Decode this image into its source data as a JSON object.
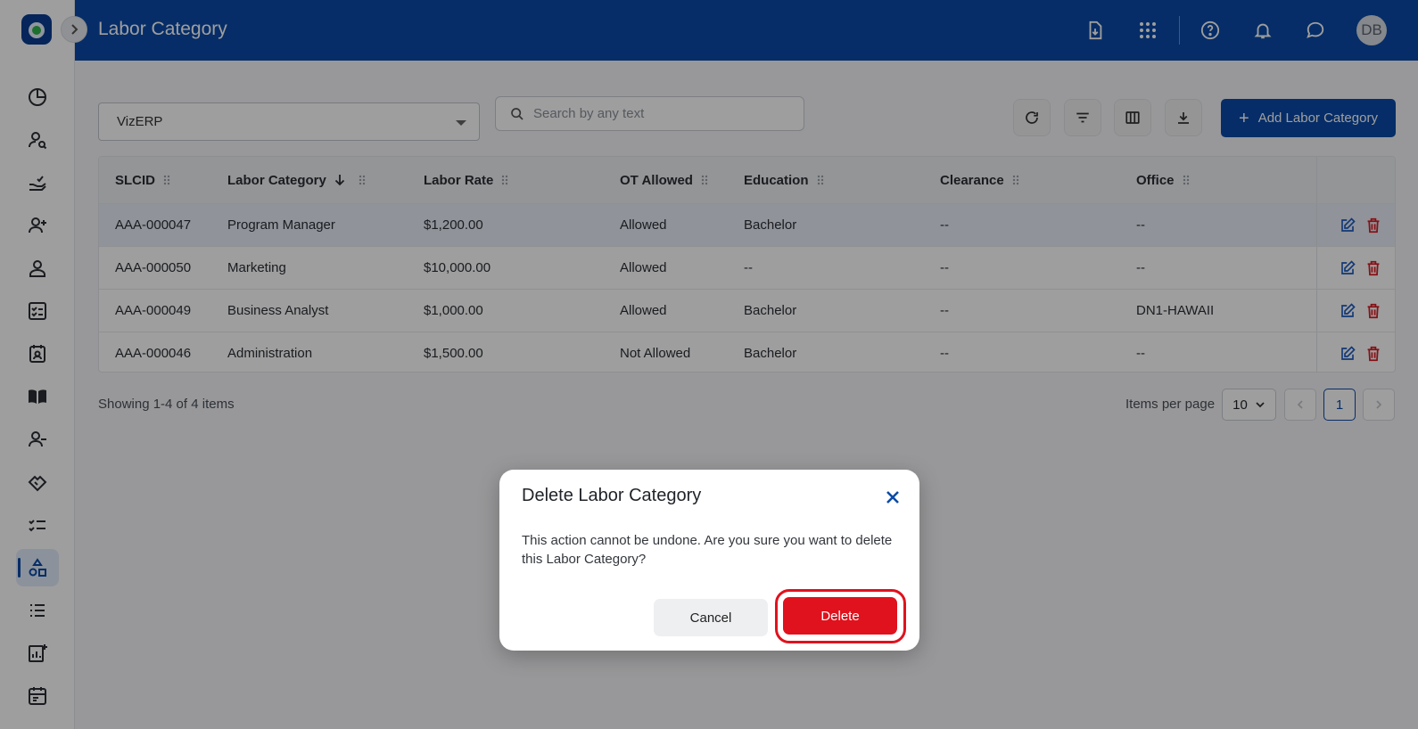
{
  "header": {
    "title": "Labor Category",
    "avatar_initials": "DB"
  },
  "sidebar": {
    "items": [
      {
        "icon": "dashboard-icon"
      },
      {
        "icon": "user-search-icon"
      },
      {
        "icon": "approve-hand-icon"
      },
      {
        "icon": "user-add-icon"
      },
      {
        "icon": "user-icon"
      },
      {
        "icon": "checklist-board-icon"
      },
      {
        "icon": "calendar-badge-icon"
      },
      {
        "icon": "book-icon"
      },
      {
        "icon": "user-remove-icon"
      },
      {
        "icon": "handshake-icon"
      },
      {
        "icon": "task-list-icon"
      },
      {
        "icon": "labor-category-icon",
        "active": true
      },
      {
        "icon": "list-icon"
      },
      {
        "icon": "report-add-icon"
      },
      {
        "icon": "calendar-icon"
      }
    ]
  },
  "toolbar": {
    "company_select": "VizERP",
    "search_placeholder": "Search by any text",
    "add_label": "Add Labor Category"
  },
  "table": {
    "columns": [
      "SLCID",
      "Labor Category",
      "Labor Rate",
      "OT Allowed",
      "Education",
      "Clearance",
      "Office"
    ],
    "rows": [
      [
        "AAA-000047",
        "Program Manager",
        "$1,200.00",
        "Allowed",
        "Bachelor",
        "--",
        "--"
      ],
      [
        "AAA-000050",
        "Marketing",
        "$10,000.00",
        "Allowed",
        "--",
        "--",
        "--"
      ],
      [
        "AAA-000049",
        "Business Analyst",
        "$1,000.00",
        "Allowed",
        "Bachelor",
        "--",
        "DN1-HAWAII"
      ],
      [
        "AAA-000046",
        "Administration",
        "$1,500.00",
        "Not Allowed",
        "Bachelor",
        "--",
        "--"
      ]
    ]
  },
  "footer": {
    "showing": "Showing 1-4 of 4 items",
    "items_per_page_label": "Items per page",
    "items_per_page": "10",
    "current_page": "1"
  },
  "modal": {
    "title": "Delete Labor Category",
    "message": "This action cannot be undone. Are you sure you want to delete this Labor Category?",
    "cancel": "Cancel",
    "delete": "Delete"
  },
  "colors": {
    "brand": "#0b4aa6",
    "danger": "#e0121d"
  }
}
